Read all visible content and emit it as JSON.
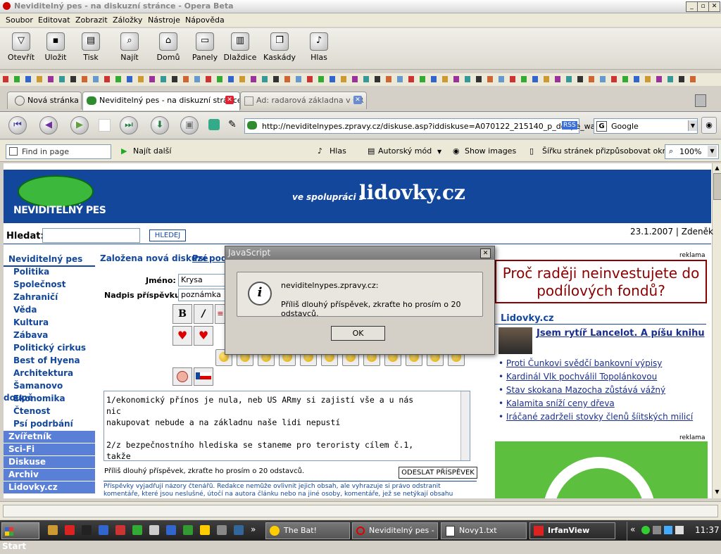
{
  "window": {
    "title": "Neviditelný pes - na diskuzní stránce - Opera Beta"
  },
  "menu": [
    "Soubor",
    "Editovat",
    "Zobrazit",
    "Záložky",
    "Nástroje",
    "Nápověda"
  ],
  "toolbar": [
    {
      "label": "Otevřít",
      "glyph": "▽",
      "icon": "open-icon"
    },
    {
      "label": "Uložit",
      "glyph": "▪",
      "icon": "save-icon"
    },
    {
      "label": "Tisk",
      "glyph": "▤",
      "icon": "print-icon"
    },
    {
      "label": "Najít",
      "glyph": "⌕",
      "icon": "search-icon"
    },
    {
      "label": "Domů",
      "glyph": "⌂",
      "icon": "home-icon"
    },
    {
      "label": "Panely",
      "glyph": "▭",
      "icon": "panels-icon"
    },
    {
      "label": "Dlaždice",
      "glyph": "▥",
      "icon": "tile-icon"
    },
    {
      "label": "Kaskády",
      "glyph": "❐",
      "icon": "cascade-icon"
    },
    {
      "label": "Hlas",
      "glyph": "♪",
      "icon": "voice-icon"
    }
  ],
  "tabs": [
    {
      "label": "Nová stránka",
      "active": false
    },
    {
      "label": "Neviditelný pes - na diskuzní stránce",
      "active": true
    },
    {
      "label": "Ad: radarová základna v ČR",
      "active": false
    }
  ],
  "address": {
    "url": "http://neviditelnypes.zpravy.cz/diskuse.asp?iddiskuse=A070122_215140_p_doupe_wag",
    "rss": "RSS"
  },
  "search": {
    "engine": "Google"
  },
  "findbar": {
    "placeholder": "Find in page",
    "find_next": "Najít další",
    "voice": "Hlas",
    "author_mode": "Autorský mód",
    "show_images": "Show images",
    "fit_width": "Šířku stránek přizpůsobovat oknu",
    "zoom": "100%"
  },
  "page": {
    "logo": "NEVIDITELNÝ PES",
    "partner_prefix": "ve spolupráci s",
    "partner": "lidovky.cz",
    "search_label": "Hledat:",
    "search_button": "HLEDEJ",
    "date_user": "23.1.2007 | Zdeněk",
    "sidebar": [
      {
        "label": "Neviditelný pes",
        "style": "head"
      },
      {
        "label": "Politika",
        "style": "plain"
      },
      {
        "label": "Společnost",
        "style": "plain"
      },
      {
        "label": "Zahraničí",
        "style": "plain"
      },
      {
        "label": "Věda",
        "style": "plain"
      },
      {
        "label": "Kultura",
        "style": "plain"
      },
      {
        "label": "Zábava",
        "style": "plain"
      },
      {
        "label": "Politický cirkus",
        "style": "plain"
      },
      {
        "label": "Best of Hyena",
        "style": "plain"
      },
      {
        "label": "Architektura",
        "style": "plain"
      },
      {
        "label": "Šamanovo doupě",
        "style": "plain"
      },
      {
        "label": "Ekonomika",
        "style": "plain"
      },
      {
        "label": "Čtenost",
        "style": "plain"
      },
      {
        "label": "Psí podrbání",
        "style": "plain"
      },
      {
        "label": "Zvířetník",
        "style": "blue"
      },
      {
        "label": "Sci-Fi",
        "style": "blue"
      },
      {
        "label": "Diskuse",
        "style": "blue"
      },
      {
        "label": "Archiv",
        "style": "blue"
      },
      {
        "label": "Lidovky.cz",
        "style": "blue"
      }
    ],
    "form": {
      "heading_text": "Založena nová diskuze",
      "heading_link": "Psí podrb",
      "name_label": "Jméno:",
      "name_value": "Krysa",
      "subject_label": "Nadpis příspěvku:",
      "subject_value": "poznámka",
      "body_text": "1/ekonomický přínos je nula, neb US ARmy si zajistí vše a u nás\nnic\nnakupovat nebude a na základnu naše lidi nepustí\n\n2/z bezpečnostního hlediska se staneme pro teroristy cílem č.1,\ntakže",
      "warning": "Příliš dlouhý příspěvek, zkraťte ho prosím o 20 odstavců.",
      "submit": "ODESLAT PŘÍSPĚVEK",
      "disclaimer": "Příspěvky vyjadřují názory čtenářů. Redakce nemůže ovlivnit jejich obsah, ale vyhrazuje si právo odstranit komentáře, které jsou neslušné, útočí na autora článku nebo na jiné osoby, komentáře, jež se netýkají obsahu uveřejněného"
    },
    "ad1": {
      "label": "reklama",
      "text": "Proč raději neinvestujete do podílových fondů?"
    },
    "lidovky": {
      "heading": "Lidovky.cz",
      "feature": "Jsem rytíř Lancelot. A píšu knihu",
      "links": [
        "Proti Čunkovi svědčí bankovní výpisy",
        "Kardinál Vlk pochválil Topolánkovou",
        "Stav skokana Mazocha zůstává vážný",
        "Kalamita sníží ceny dřeva",
        "Iráčané zadrželi stovky členů šíitských milicí"
      ]
    },
    "ad2": {
      "label": "reklama"
    }
  },
  "dialog": {
    "title": "JavaScript",
    "origin": "neviditelnypes.zpravy.cz:",
    "message": "Příliš dlouhý příspěvek, zkraťte ho prosím o 20 odstavců.",
    "ok": "OK"
  },
  "taskbar": {
    "start": "Start",
    "tasks": [
      "The Bat!",
      "Neviditelný pes - ...",
      "Novy1.txt",
      "IrfanView"
    ],
    "clock": "11:37"
  },
  "colors": {
    "brand_blue": "#13479b",
    "ad_red": "#8b0000",
    "link_blue": "#1a2f8f"
  }
}
